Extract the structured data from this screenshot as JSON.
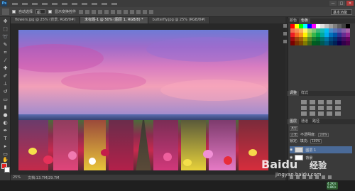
{
  "app": {
    "logo": "Ps"
  },
  "window_controls": {
    "minimize": "—",
    "maximize": "□",
    "close": "✕"
  },
  "options_bar": {
    "auto_select_label": "自动选择",
    "auto_select_value": "组",
    "show_transform_label": "显示变换控件",
    "workspace": "基本功能"
  },
  "tabs": [
    {
      "label": "flowers.jpg @ 25% (背景, RGB/8#)"
    },
    {
      "label": "未标题-1 @ 50% (图层 1, RGB/8) *"
    },
    {
      "label": "butterfly.jpg @ 25% (RGB/8#)"
    }
  ],
  "status_bar": {
    "zoom": "25%",
    "doc_info": "文档:13.7M/29.7M"
  },
  "right_panel": {
    "swatch_tabs": [
      "颜色",
      "色板"
    ],
    "adjust_tabs": [
      "调整",
      "样式"
    ],
    "layers_tabs": [
      "图层",
      "通道",
      "路径"
    ],
    "blend_mode": "正常",
    "opacity_label": "不透明度:",
    "opacity": "100%",
    "lock_label": "锁定:",
    "fill_label": "填充:",
    "fill": "100%",
    "layer_kind": "类型",
    "layers": [
      {
        "name": "图层 1",
        "active": true
      },
      {
        "name": "背景",
        "active": false
      }
    ]
  },
  "taskbar": {
    "line1": "4.2K/s",
    "line2": "0.8K/s"
  },
  "watermark": {
    "brand": "Baidu",
    "suffix": "经验",
    "url": "jingyan.baidu.com"
  },
  "colors": {
    "foreground": "#e32121",
    "background": "#ffffff",
    "ui_panel": "#3a3a3a",
    "active_layer": "#4a6a98"
  },
  "swatch_colors": [
    "#ff0000",
    "#ffff00",
    "#00ff00",
    "#00ffff",
    "#0000ff",
    "#ff00ff",
    "#ffffff",
    "#e0e0e0",
    "#c0c0c0",
    "#a0a0a0",
    "#808080",
    "#606060",
    "#404040",
    "#000000",
    "#f26c4f",
    "#f68e55",
    "#fbaf5c",
    "#fff467",
    "#acd372",
    "#7cc576",
    "#3bb878",
    "#1abbb4",
    "#00bff3",
    "#438cca",
    "#5574b9",
    "#605ca8",
    "#855fa8",
    "#a763a8",
    "#ed1c24",
    "#f26522",
    "#f7941d",
    "#fff200",
    "#8dc63f",
    "#39b54a",
    "#00a651",
    "#00a99d",
    "#00aeef",
    "#0072bc",
    "#0054a6",
    "#2e3192",
    "#662d91",
    "#92278f",
    "#9e0b0f",
    "#a0410d",
    "#a3620a",
    "#aba000",
    "#598527",
    "#1a7b30",
    "#007236",
    "#00746b",
    "#0076a3",
    "#004b80",
    "#003471",
    "#1b1464",
    "#440e62",
    "#630460",
    "#790000",
    "#7b2e00",
    "#7d4900",
    "#827b00",
    "#406618",
    "#005e20",
    "#005826",
    "#005952",
    "#005b7f",
    "#003663",
    "#002157",
    "#0d004c",
    "#32004b",
    "#4b0049"
  ]
}
